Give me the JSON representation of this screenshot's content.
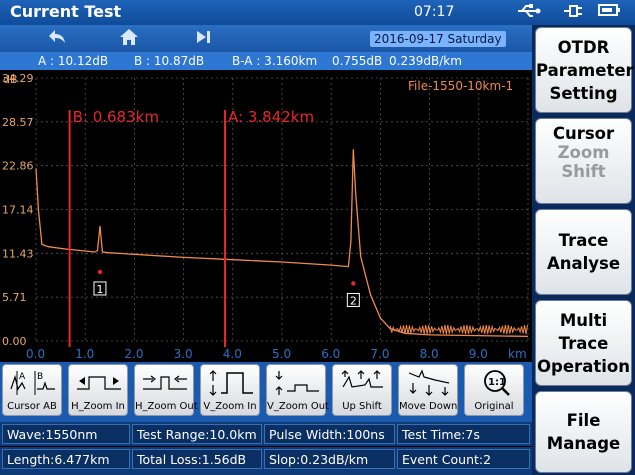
{
  "titlebar": {
    "title": "Current Test",
    "time": "07:17",
    "usb_icon": "usb-icon",
    "plug_icon": "plug-icon",
    "battery_icon": "battery-icon"
  },
  "navbar": {
    "back_icon": "back-arrow-icon",
    "home_icon": "home-icon",
    "next_icon": "skip-forward-icon",
    "date": "2016-09-17 Saturday"
  },
  "infobar": {
    "a": "A : 10.12dB",
    "b": "B : 10.87dB",
    "ba_dist": "B-A : 3.160km",
    "ba_db": "0.755dB",
    "ba_rate": "0.239dB/km"
  },
  "chart_data": {
    "type": "line",
    "file_label": "File-1550-10km-1",
    "ylabel": "dB",
    "xlabel": "km",
    "y_ticks": [
      "34.29",
      "28.57",
      "22.86",
      "17.14",
      "11.43",
      "5.71",
      "0.00"
    ],
    "x_ticks": [
      "0.0",
      "1.0",
      "2.0",
      "3.0",
      "4.0",
      "5.0",
      "6.0",
      "7.0",
      "8.0",
      "9.0"
    ],
    "xlim": [
      0,
      10
    ],
    "ylim": [
      0,
      34.29
    ],
    "cursor_a": {
      "label": "A: 3.842km",
      "x": 3.842
    },
    "cursor_b": {
      "label": "B: 0.683km",
      "x": 0.683
    },
    "events": [
      {
        "label": "1",
        "x": 1.3,
        "y": 9.0
      },
      {
        "label": "2",
        "x": 6.45,
        "y": 7.5
      }
    ],
    "trace": [
      [
        0.0,
        22.5
      ],
      [
        0.05,
        17.0
      ],
      [
        0.12,
        12.6
      ],
      [
        0.25,
        12.3
      ],
      [
        0.6,
        12.0
      ],
      [
        1.2,
        11.6
      ],
      [
        1.25,
        11.8
      ],
      [
        1.3,
        15.0
      ],
      [
        1.35,
        11.6
      ],
      [
        1.5,
        11.5
      ],
      [
        2.0,
        11.3
      ],
      [
        3.0,
        10.9
      ],
      [
        4.0,
        10.6
      ],
      [
        5.0,
        10.3
      ],
      [
        6.0,
        9.9
      ],
      [
        6.35,
        9.7
      ],
      [
        6.4,
        13.0
      ],
      [
        6.45,
        25.0
      ],
      [
        6.5,
        19.0
      ],
      [
        6.6,
        11.0
      ],
      [
        6.8,
        6.0
      ],
      [
        7.0,
        3.0
      ],
      [
        7.2,
        1.6
      ],
      [
        7.5,
        1.0
      ],
      [
        8.0,
        0.8
      ],
      [
        9.0,
        0.7
      ],
      [
        10.0,
        0.6
      ]
    ]
  },
  "toolbar": [
    {
      "name": "cursor-ab-button",
      "label": "Cursor AB"
    },
    {
      "name": "h-zoom-in-button",
      "label": "H_Zoom In"
    },
    {
      "name": "h-zoom-out-button",
      "label": "H_Zoom Out"
    },
    {
      "name": "v-zoom-in-button",
      "label": "V_Zoom In"
    },
    {
      "name": "v-zoom-out-button",
      "label": "V_Zoom Out"
    },
    {
      "name": "up-shift-button",
      "label": "Up Shift"
    },
    {
      "name": "move-down-button",
      "label": "Move Down"
    },
    {
      "name": "original-button",
      "label": "Original",
      "icon_text": "1:1"
    }
  ],
  "status1": {
    "wave": "Wave:1550nm",
    "range": "Test Range:10.0km",
    "pulse": "Pulse Width:100ns",
    "time": "Test Time:7s"
  },
  "status2": {
    "length": "Length:6.477km",
    "loss": "Total Loss:1.56dB",
    "slop": "Slop:0.23dB/km",
    "events": "Event Count:2"
  },
  "right": {
    "otdr": [
      "OTDR",
      "Parameter",
      "Setting"
    ],
    "cursor": [
      "Cursor",
      "Zoom",
      "Shift"
    ],
    "trace": [
      "Trace",
      "Analyse"
    ],
    "multi": [
      "Multi",
      "Trace",
      "Operation"
    ],
    "file": [
      "File",
      "Manage"
    ]
  },
  "colors": {
    "trace": "#f08a4b",
    "cursor": "#e8262a",
    "grid": "#555555",
    "axis_label": "#e6a868",
    "x_axis_label": "#2a6fc3"
  }
}
